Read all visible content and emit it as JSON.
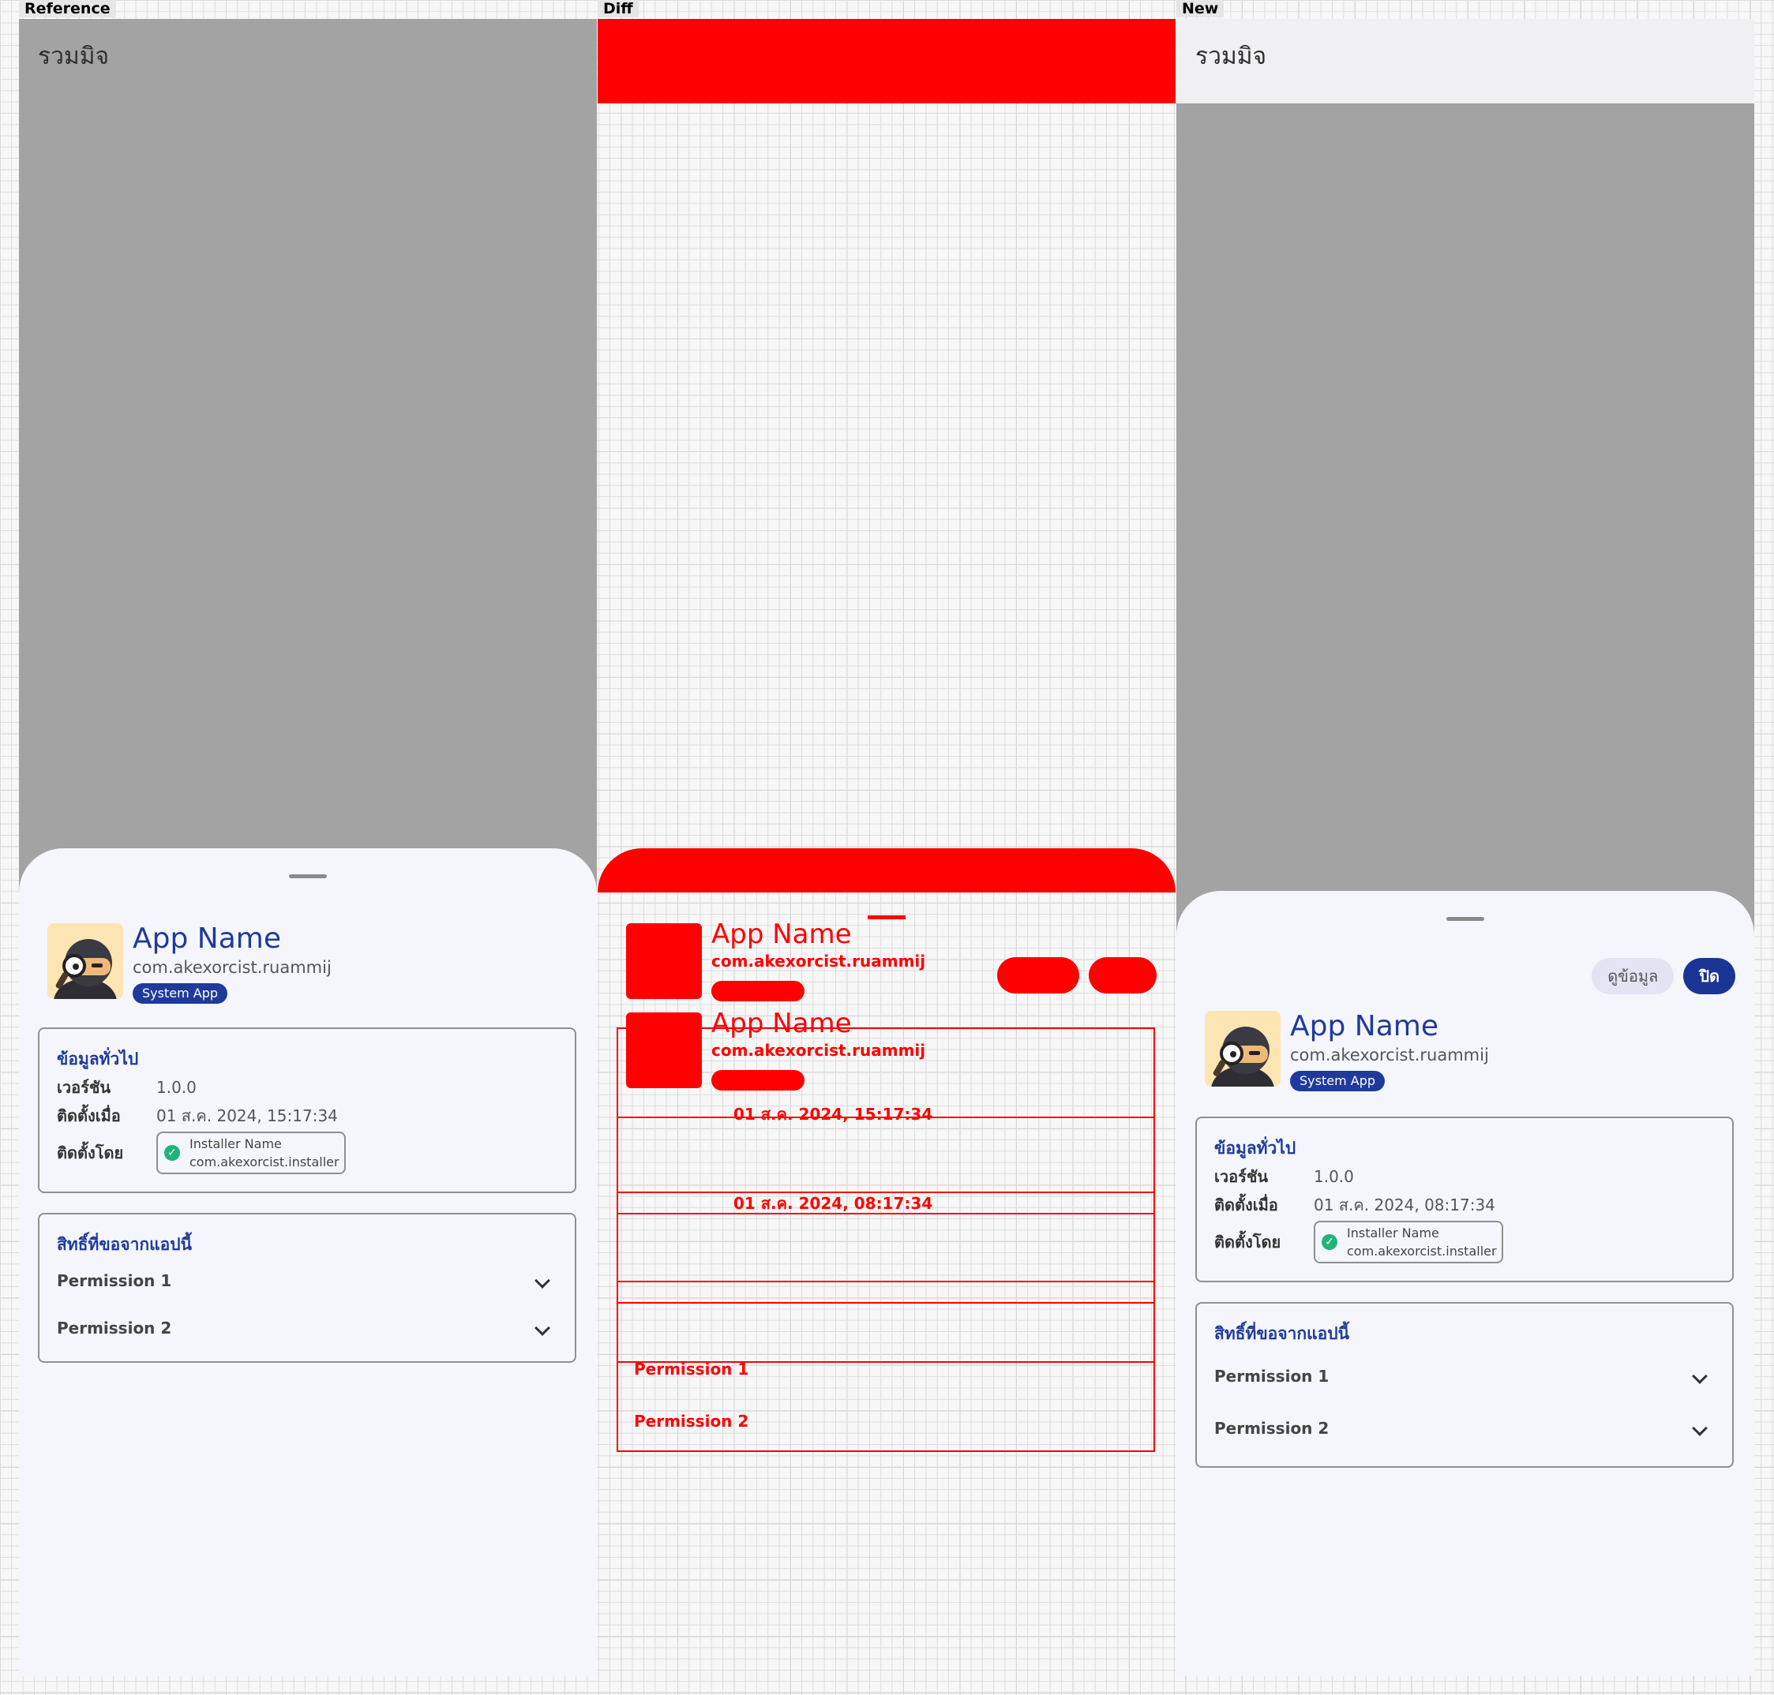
{
  "labels": {
    "reference": "Reference",
    "diff": "Diff",
    "new": "New"
  },
  "topbar": {
    "title": "รวมมิจ"
  },
  "actions": {
    "info_label": "ดูข้อมูล",
    "close_label": "ปิด"
  },
  "app": {
    "name": "App Name",
    "package": "com.akexorcist.ruammij",
    "badge": "System App"
  },
  "general": {
    "title": "ข้อมูลทั่วไป",
    "version_label": "เวอร์ชัน",
    "version": "1.0.0",
    "installed_at_label": "ติดตั้งเมื่อ",
    "installed_by_label": "ติดตั้งโดย",
    "installer_name": "Installer Name",
    "installer_package": "com.akexorcist.installer"
  },
  "reference": {
    "installed_at": "01 ส.ค. 2024, 15:17:34"
  },
  "new": {
    "installed_at": "01 ส.ค. 2024, 08:17:34"
  },
  "permissions": {
    "title": "สิทธิ์ที่ขอจากแอปนี้",
    "items": [
      {
        "label": "Permission 1"
      },
      {
        "label": "Permission 2"
      }
    ]
  },
  "colors": {
    "accent": "#1f3a9a",
    "diff": "#ff0000",
    "check": "#1fb47a"
  },
  "icons": {
    "installer_check": "check-circle-icon",
    "expand": "chevron-down-icon"
  }
}
